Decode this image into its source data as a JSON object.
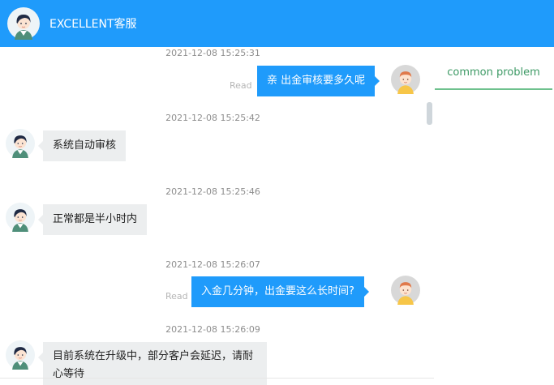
{
  "header": {
    "title": "EXCELLENT客服"
  },
  "side": {
    "tab_label": "common problem"
  },
  "read_label": "Read",
  "messages": [
    {
      "time": "2021-12-08 15:25:31",
      "from": "user",
      "text": "亲 出金审核要多久呢"
    },
    {
      "time": "2021-12-08 15:25:42",
      "from": "agent",
      "text": "系统自动审核"
    },
    {
      "time": "2021-12-08 15:25:46",
      "from": "agent",
      "text": "正常都是半小时内"
    },
    {
      "time": "2021-12-08 15:26:07",
      "from": "user",
      "text": "入金几分钟，出金要这么长时间?"
    },
    {
      "time": "2021-12-08 15:26:09",
      "from": "agent",
      "text": "目前系统在升级中，部分客户会延迟，请耐心等待"
    }
  ],
  "colors": {
    "header": "#1f9bfb",
    "sent_bubble": "#1f9bfb",
    "recv_bubble": "#eceeef",
    "tab_accent": "#6ec18d"
  },
  "icons": {
    "agent_avatar": "agent-avatar-icon",
    "user_avatar": "user-avatar-icon"
  }
}
